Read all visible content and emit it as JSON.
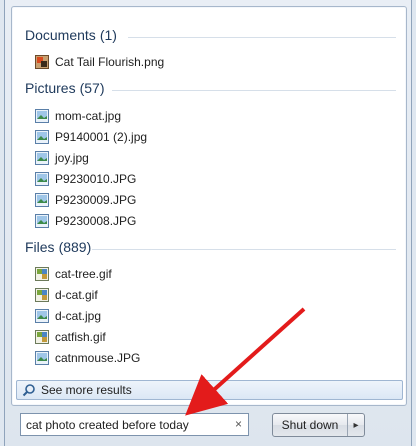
{
  "results": {
    "groups": [
      {
        "name": "Documents",
        "count": "(1)",
        "items": [
          {
            "label": "Cat Tail Flourish.png",
            "icon": "png-image-icon"
          }
        ]
      },
      {
        "name": "Pictures",
        "count": "(57)",
        "items": [
          {
            "label": "mom-cat.jpg",
            "icon": "jpg-image-icon"
          },
          {
            "label": "P9140001 (2).jpg",
            "icon": "jpg-image-icon"
          },
          {
            "label": "joy.jpg",
            "icon": "jpg-image-icon"
          },
          {
            "label": "P9230010.JPG",
            "icon": "jpg-image-icon"
          },
          {
            "label": "P9230009.JPG",
            "icon": "jpg-image-icon"
          },
          {
            "label": "P9230008.JPG",
            "icon": "jpg-image-icon"
          }
        ]
      },
      {
        "name": "Files",
        "count": "(889)",
        "items": [
          {
            "label": "cat-tree.gif",
            "icon": "gif-image-icon"
          },
          {
            "label": "d-cat.gif",
            "icon": "gif-image-icon"
          },
          {
            "label": "d-cat.jpg",
            "icon": "jpg-image-icon"
          },
          {
            "label": "catfish.gif",
            "icon": "gif-image-icon"
          },
          {
            "label": "catnmouse.JPG",
            "icon": "jpg-image-icon"
          }
        ]
      }
    ],
    "see_more": "See more results"
  },
  "search": {
    "value": "cat photo created before today",
    "clear_glyph": "×"
  },
  "power": {
    "shutdown_label": "Shut down",
    "arrow_glyph": "▸"
  },
  "colors": {
    "header": "#1e395b",
    "annotation_arrow": "#e31b1b"
  }
}
